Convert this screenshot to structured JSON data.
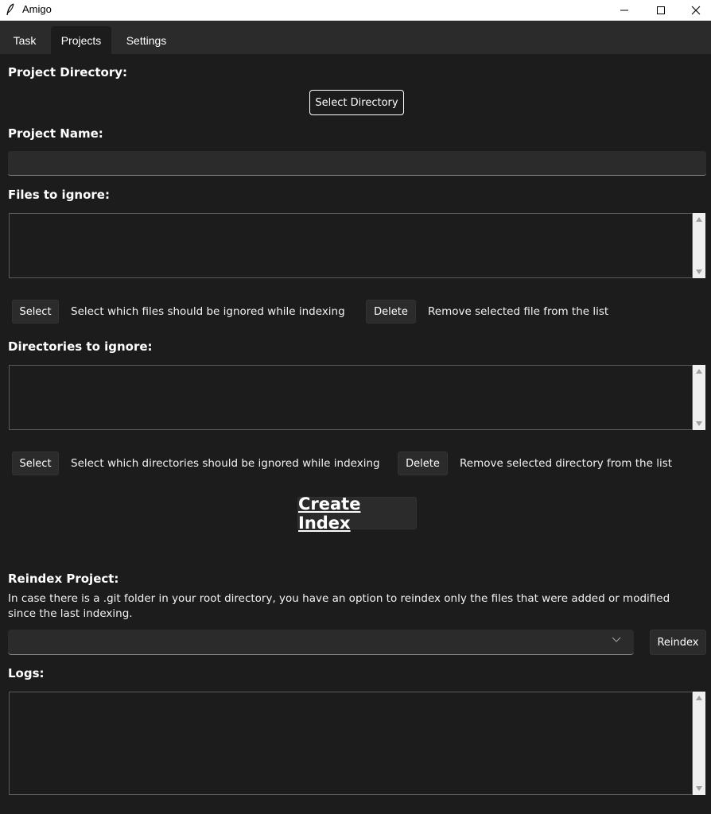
{
  "window": {
    "title": "Amigo",
    "icon": "feather-icon"
  },
  "tabs": [
    {
      "label": "Task"
    },
    {
      "label": "Projects",
      "selected": true
    },
    {
      "label": "Settings"
    }
  ],
  "project_directory": {
    "label": "Project Directory:",
    "button": "Select Directory"
  },
  "project_name": {
    "label": "Project Name:",
    "value": ""
  },
  "files_to_ignore": {
    "label": "Files to ignore:",
    "select_button": "Select",
    "select_desc": "Select which files should be ignored while indexing",
    "delete_button": "Delete",
    "delete_desc": "Remove selected file from the list"
  },
  "directories_to_ignore": {
    "label": "Directories to ignore:",
    "select_button": "Select",
    "select_desc": "Select which directories should be ignored while indexing",
    "delete_button": "Delete",
    "delete_desc": "Remove selected directory from the list"
  },
  "create_index": {
    "label": "Create Index"
  },
  "reindex": {
    "label": "Reindex Project:",
    "desc": "In case there is a .git folder in your root directory, you have an option to reindex only the files that were added or modified since the last indexing.",
    "selected": "",
    "button": "Reindex"
  },
  "logs": {
    "label": "Logs:"
  },
  "colors": {
    "background": "#1c1c1c",
    "panel": "#2b2b2b",
    "text": "#ffffff"
  }
}
